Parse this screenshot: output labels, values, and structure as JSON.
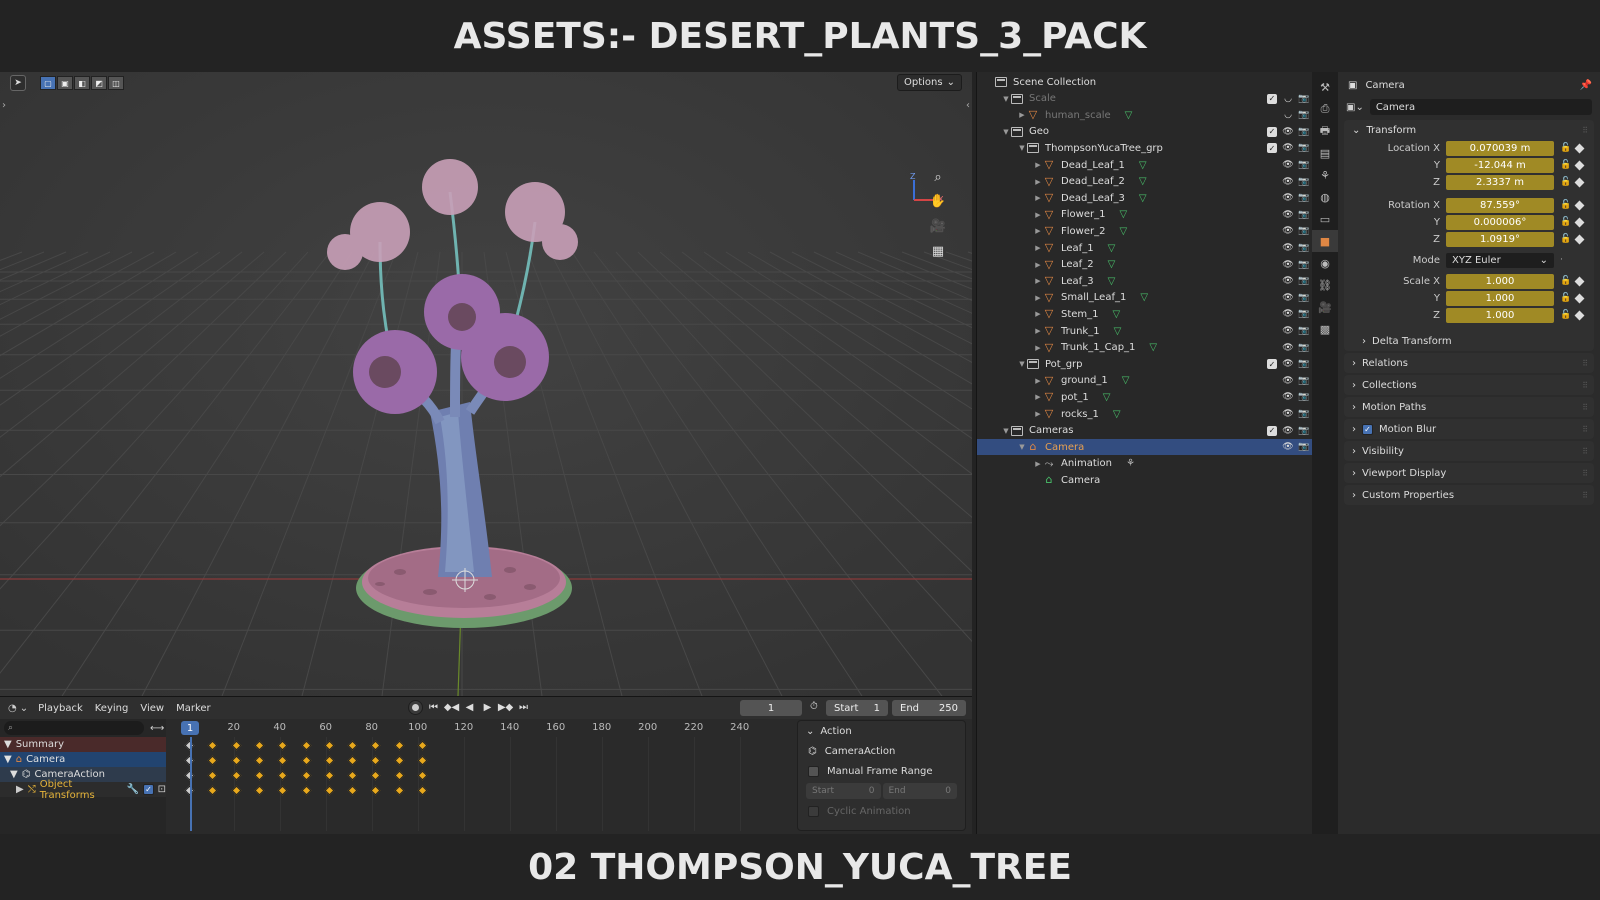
{
  "banner": {
    "top": "ASSETS:- DESERT_PLANTS_3_PACK",
    "bottom": "02 THOMPSON_YUCA_TREE"
  },
  "viewport": {
    "options_label": "Options",
    "gizmo_x": "X",
    "gizmo_z": "Z"
  },
  "timeline": {
    "menus": [
      "Playback",
      "Keying",
      "View",
      "Marker"
    ],
    "current_frame": "1",
    "start_label": "Start",
    "start_value": "1",
    "end_label": "End",
    "end_value": "250",
    "ruler": [
      {
        "label": "1",
        "frame": 1
      },
      {
        "label": "20",
        "frame": 20
      },
      {
        "label": "40",
        "frame": 40
      },
      {
        "label": "60",
        "frame": 60
      },
      {
        "label": "80",
        "frame": 80
      },
      {
        "label": "100",
        "frame": 100
      },
      {
        "label": "120",
        "frame": 120
      },
      {
        "label": "140",
        "frame": 140
      },
      {
        "label": "160",
        "frame": 160
      },
      {
        "label": "180",
        "frame": 180
      },
      {
        "label": "200",
        "frame": 200
      },
      {
        "label": "220",
        "frame": 220
      },
      {
        "label": "240",
        "frame": 240
      }
    ],
    "keyframes": [
      0,
      10,
      20,
      30,
      40,
      50,
      60,
      70,
      80,
      90,
      100
    ],
    "channels": {
      "summary": "Summary",
      "camera": "Camera",
      "action": "CameraAction",
      "object_transforms": "Object Transforms"
    }
  },
  "action_panel": {
    "title": "Action",
    "action_name": "CameraAction",
    "manual_range": "Manual Frame Range",
    "start_label": "Start",
    "start_value": "0",
    "end_label": "End",
    "end_value": "0",
    "cyclic": "Cyclic Animation"
  },
  "outliner": {
    "rows": [
      {
        "label": "Scene Collection",
        "depth": 0,
        "kind": "scene",
        "tri": ""
      },
      {
        "label": "Scale",
        "depth": 1,
        "kind": "coll",
        "tri": "▼",
        "dim": true
      },
      {
        "label": "human_scale",
        "depth": 2,
        "kind": "obj",
        "tri": "▶",
        "dim": true,
        "mesh": true
      },
      {
        "label": "Geo",
        "depth": 1,
        "kind": "coll",
        "tri": "▼"
      },
      {
        "label": "ThompsonYucaTree_grp",
        "depth": 2,
        "kind": "coll",
        "tri": "▼"
      },
      {
        "label": "Dead_Leaf_1",
        "depth": 3,
        "kind": "obj",
        "tri": "▶",
        "mesh": true
      },
      {
        "label": "Dead_Leaf_2",
        "depth": 3,
        "kind": "obj",
        "tri": "▶",
        "mesh": true
      },
      {
        "label": "Dead_Leaf_3",
        "depth": 3,
        "kind": "obj",
        "tri": "▶",
        "mesh": true
      },
      {
        "label": "Flower_1",
        "depth": 3,
        "kind": "obj",
        "tri": "▶",
        "mesh": true
      },
      {
        "label": "Flower_2",
        "depth": 3,
        "kind": "obj",
        "tri": "▶",
        "mesh": true
      },
      {
        "label": "Leaf_1",
        "depth": 3,
        "kind": "obj",
        "tri": "▶",
        "mesh": true
      },
      {
        "label": "Leaf_2",
        "depth": 3,
        "kind": "obj",
        "tri": "▶",
        "mesh": true
      },
      {
        "label": "Leaf_3",
        "depth": 3,
        "kind": "obj",
        "tri": "▶",
        "mesh": true
      },
      {
        "label": "Small_Leaf_1",
        "depth": 3,
        "kind": "obj",
        "tri": "▶",
        "mesh": true
      },
      {
        "label": "Stem_1",
        "depth": 3,
        "kind": "obj",
        "tri": "▶",
        "mesh": true
      },
      {
        "label": "Trunk_1",
        "depth": 3,
        "kind": "obj",
        "tri": "▶",
        "mesh": true
      },
      {
        "label": "Trunk_1_Cap_1",
        "depth": 3,
        "kind": "obj",
        "tri": "▶",
        "mesh": true
      },
      {
        "label": "Pot_grp",
        "depth": 2,
        "kind": "coll",
        "tri": "▼"
      },
      {
        "label": "ground_1",
        "depth": 3,
        "kind": "obj",
        "tri": "▶",
        "mesh": true
      },
      {
        "label": "pot_1",
        "depth": 3,
        "kind": "obj",
        "tri": "▶",
        "mesh": true
      },
      {
        "label": "rocks_1",
        "depth": 3,
        "kind": "obj",
        "tri": "▶",
        "mesh": true
      },
      {
        "label": "Cameras",
        "depth": 1,
        "kind": "coll",
        "tri": "▼"
      },
      {
        "label": "Camera",
        "depth": 2,
        "kind": "camobj",
        "tri": "▼",
        "selected": true
      },
      {
        "label": "Animation",
        "depth": 3,
        "kind": "anim",
        "tri": "▶"
      },
      {
        "label": "Camera",
        "depth": 3,
        "kind": "camdata",
        "tri": ""
      }
    ]
  },
  "properties": {
    "header": "Camera",
    "object_name": "Camera",
    "transform_title": "Transform",
    "location": [
      {
        "label": "Location X",
        "value": "0.070039 m"
      },
      {
        "label": "Y",
        "value": "-12.044 m"
      },
      {
        "label": "Z",
        "value": "2.3337 m"
      }
    ],
    "rotation": [
      {
        "label": "Rotation X",
        "value": "87.559°"
      },
      {
        "label": "Y",
        "value": "0.000006°"
      },
      {
        "label": "Z",
        "value": "1.0919°"
      }
    ],
    "mode_label": "Mode",
    "mode_value": "XYZ Euler",
    "scale": [
      {
        "label": "Scale X",
        "value": "1.000"
      },
      {
        "label": "Y",
        "value": "1.000"
      },
      {
        "label": "Z",
        "value": "1.000"
      }
    ],
    "delta_transform": "Delta Transform",
    "panels": [
      "Relations",
      "Collections",
      "Motion Paths",
      "Motion Blur",
      "Visibility",
      "Viewport Display",
      "Custom Properties"
    ]
  },
  "colors": {
    "accent": "#4772b3",
    "keyframe": "#e8a81c",
    "field_animated": "#a08a25",
    "object_orange": "#e08744",
    "mesh_green": "#49c06a"
  }
}
